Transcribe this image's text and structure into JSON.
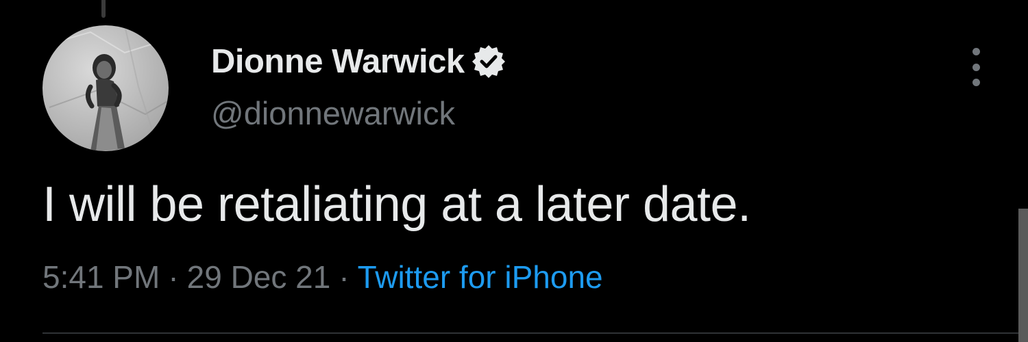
{
  "tweet": {
    "author": {
      "display_name": "Dionne Warwick",
      "handle": "@dionnewarwick",
      "verified": true,
      "avatar_icon": "avatar-photo"
    },
    "text": "I will be retaliating at a later date.",
    "time": "5:41 PM",
    "date": "29 Dec 21",
    "separator": "·",
    "source": "Twitter for iPhone",
    "more_icon": "more-vertical-icon"
  },
  "colors": {
    "background": "#000000",
    "primary_text": "#e7e9ea",
    "secondary_text": "#71767b",
    "link": "#1d9bf0",
    "divider": "#2f3336"
  }
}
